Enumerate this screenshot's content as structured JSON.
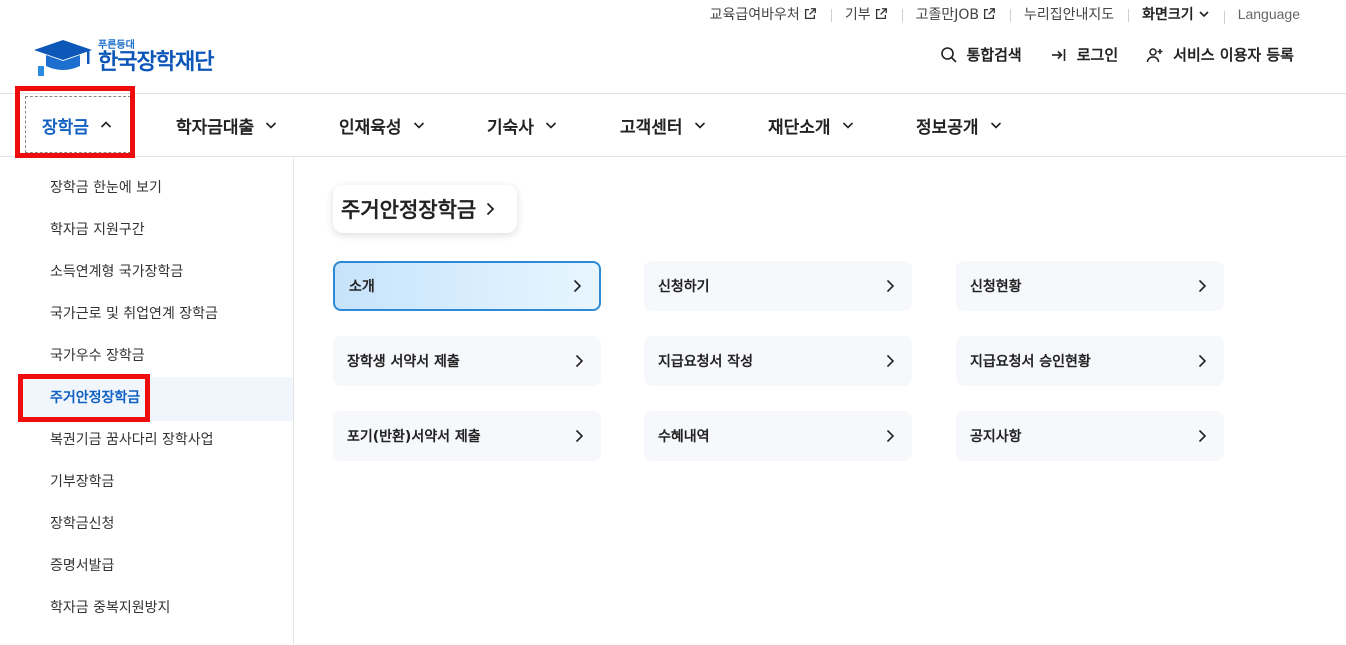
{
  "utility": {
    "voucher": "교육급여바우처",
    "donate": "기부",
    "job": "고졸만JOB",
    "nuri": "누리집안내지도",
    "screen_size": "화면크기",
    "language": "Language"
  },
  "logo": {
    "sub": "푸른등대",
    "main": "한국장학재단"
  },
  "header": {
    "search": "통합검색",
    "login": "로그인",
    "register": "서비스 이용자 등록"
  },
  "gnb": {
    "items": [
      {
        "label": "장학금"
      },
      {
        "label": "학자금대출"
      },
      {
        "label": "인재육성"
      },
      {
        "label": "기숙사"
      },
      {
        "label": "고객센터"
      },
      {
        "label": "재단소개"
      },
      {
        "label": "정보공개"
      }
    ]
  },
  "sidebar": {
    "items": [
      {
        "label": "장학금 한눈에 보기"
      },
      {
        "label": "학자금 지원구간"
      },
      {
        "label": "소득연계형 국가장학금"
      },
      {
        "label": "국가근로 및 취업연계 장학금"
      },
      {
        "label": "국가우수 장학금"
      },
      {
        "label": "주거안정장학금"
      },
      {
        "label": "복권기금 꿈사다리 장학사업"
      },
      {
        "label": "기부장학금"
      },
      {
        "label": "장학금신청"
      },
      {
        "label": "증명서발급"
      },
      {
        "label": "학자금 중복지원방지"
      }
    ]
  },
  "main": {
    "title": "주거안정장학금",
    "cards": [
      {
        "label": "소개"
      },
      {
        "label": "신청하기"
      },
      {
        "label": "신청현황"
      },
      {
        "label": "장학생 서약서 제출"
      },
      {
        "label": "지급요청서 작성"
      },
      {
        "label": "지급요청서 승인현황"
      },
      {
        "label": "포기(반환)서약서 제출"
      },
      {
        "label": "수혜내역"
      },
      {
        "label": "공지사항"
      }
    ]
  },
  "colors": {
    "brand_blue": "#1160c4",
    "highlight_red": "#ee0c0c",
    "active_card_border": "#2d8ad6"
  }
}
